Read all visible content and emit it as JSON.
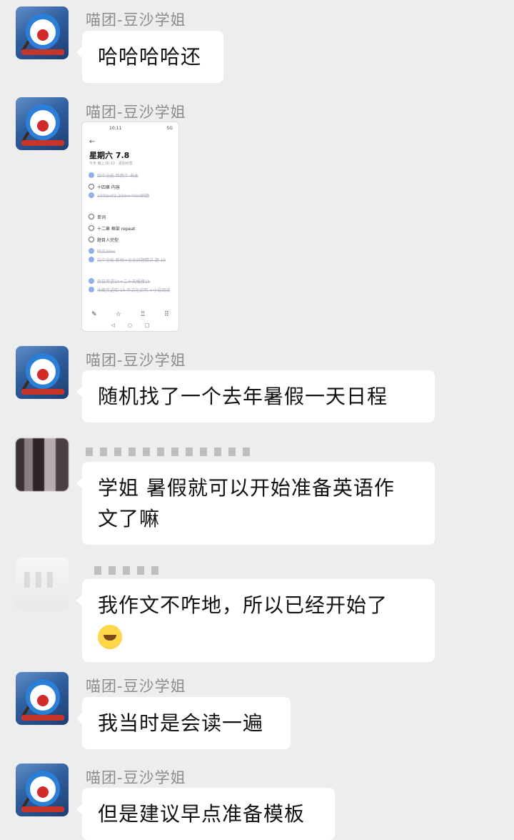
{
  "messages": [
    {
      "sender": "喵团-豆沙学姐",
      "type": "text",
      "text": "哈哈哈哈还"
    },
    {
      "sender": "喵团-豆沙学姐",
      "type": "image",
      "screenshot": {
        "status_time": "10:11",
        "status_right": "5G",
        "back_glyph": "←",
        "title": "星期六 7.8",
        "subtitle": "今天 晚上10:10 · 添加标签",
        "tasks": [
          {
            "text": "四个全能 听两个 书本",
            "done": true
          },
          {
            "text": "十四章 内容",
            "done": false
          },
          {
            "text": "100text1 20m+40m刷题",
            "done": true
          },
          {
            "text": "单词",
            "done": false
          },
          {
            "text": "十二章 框架 repeat",
            "done": false
          },
          {
            "text": "题目人完型",
            "done": false
          },
          {
            "text": "听文30m",
            "done": true
          },
          {
            "text": "四个全能 新材+全全好题精讲 题 1h",
            "done": true
          },
          {
            "text": "周日英语1h+二十天报搜1h",
            "done": true
          },
          {
            "text": "收藏英语知 1h 听文化说明 +小说阅读",
            "done": true
          }
        ],
        "tabbar": [
          "✎",
          "☆",
          "♖",
          "⠿"
        ],
        "nav": [
          "◁",
          "○",
          "□"
        ]
      }
    },
    {
      "sender": "喵团-豆沙学姐",
      "type": "text",
      "text": "随机找了一个去年暑假一天日程"
    },
    {
      "sender": "",
      "type": "text",
      "lines": [
        "学姐  暑假就可以开始准备英语作",
        "文了嘛"
      ]
    },
    {
      "sender": "",
      "type": "text",
      "lines": [
        "我作文不咋地，所以已经开始了",
        ""
      ]
    },
    {
      "sender": "喵团-豆沙学姐",
      "type": "text",
      "text": "我当时是会读一遍"
    },
    {
      "sender": "喵团-豆沙学姐",
      "type": "text",
      "text": "但是建议早点准备模板"
    }
  ],
  "icons": {
    "dora_avatar": "doraemon-avatar",
    "emoji": "facepalm-emoji"
  }
}
